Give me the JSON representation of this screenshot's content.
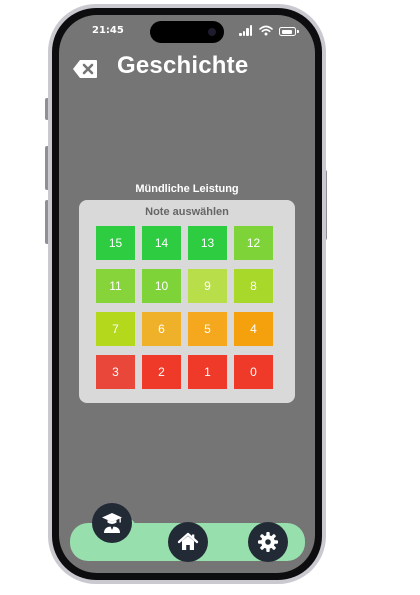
{
  "status_bar": {
    "time": "21:45"
  },
  "header": {
    "title": "Geschichte",
    "back_icon": "backspace-x-icon"
  },
  "section": {
    "label": "Mündliche Leistung"
  },
  "grade_picker": {
    "title": "Note auswählen",
    "grades": [
      {
        "value": "15",
        "color": "#2ecc40"
      },
      {
        "value": "14",
        "color": "#2ecc40"
      },
      {
        "value": "13",
        "color": "#2ecc40"
      },
      {
        "value": "12",
        "color": "#7ed339"
      },
      {
        "value": "11",
        "color": "#86d43a"
      },
      {
        "value": "10",
        "color": "#7ed339"
      },
      {
        "value": "9",
        "color": "#b8df4a"
      },
      {
        "value": "8",
        "color": "#a8d82a"
      },
      {
        "value": "7",
        "color": "#b4d91c"
      },
      {
        "value": "6",
        "color": "#f0b12a"
      },
      {
        "value": "5",
        "color": "#f5a81d"
      },
      {
        "value": "4",
        "color": "#f5a10e"
      },
      {
        "value": "3",
        "color": "#e8473a"
      },
      {
        "value": "2",
        "color": "#ef3a2a"
      },
      {
        "value": "1",
        "color": "#ef3a2a"
      },
      {
        "value": "0",
        "color": "#ef3a2a"
      }
    ]
  },
  "nav": {
    "items": [
      {
        "icon": "student-graduate-icon"
      },
      {
        "icon": "home-icon"
      },
      {
        "icon": "gear-icon"
      }
    ],
    "bar_color": "#98dfae",
    "button_color": "#222a36"
  }
}
